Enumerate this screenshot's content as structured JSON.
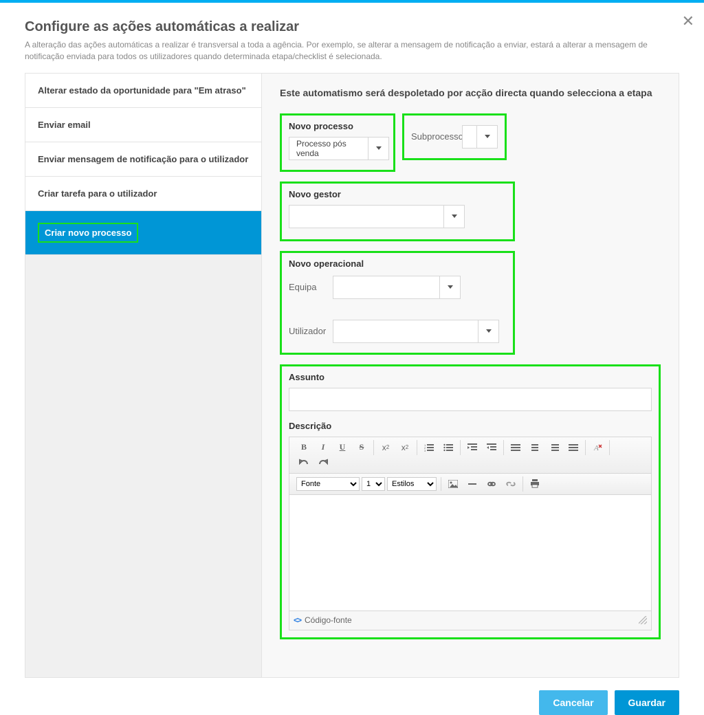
{
  "header": {
    "title": "Configure as ações automáticas a realizar",
    "subtitle": "A alteração das ações automáticas a realizar é transversal a toda a agência. Por exemplo, se alterar a mensagem de notificação a enviar, estará a alterar a mensagem de notificação enviada para todos os utilizadores quando determinada etapa/checklist é selecionada."
  },
  "tabs": [
    {
      "label": "Alterar estado da oportunidade para \"Em atraso\""
    },
    {
      "label": "Enviar email"
    },
    {
      "label": "Enviar mensagem de notificação para o utilizador"
    },
    {
      "label": "Criar tarefa para o utilizador"
    },
    {
      "label": "Criar novo processo"
    }
  ],
  "content": {
    "trigger_text": "Este automatismo será despoletado por acção directa quando selecciona a etapa",
    "novo_processo": {
      "label": "Novo processo",
      "value": "Processo pós venda"
    },
    "subprocesso": {
      "label": "Subprocesso:",
      "value": ""
    },
    "novo_gestor": {
      "label": "Novo gestor",
      "value": ""
    },
    "novo_operacional": {
      "label": "Novo operacional",
      "equipa_label": "Equipa",
      "equipa_value": "",
      "utilizador_label": "Utilizador",
      "utilizador_value": ""
    },
    "assunto": {
      "label": "Assunto",
      "value": ""
    },
    "descricao": {
      "label": "Descrição",
      "fonte_label": "Fonte",
      "size_label": "1",
      "estilos_label": "Estilos",
      "codigo_fonte": "Código-fonte"
    }
  },
  "footer": {
    "cancel": "Cancelar",
    "save": "Guardar"
  }
}
